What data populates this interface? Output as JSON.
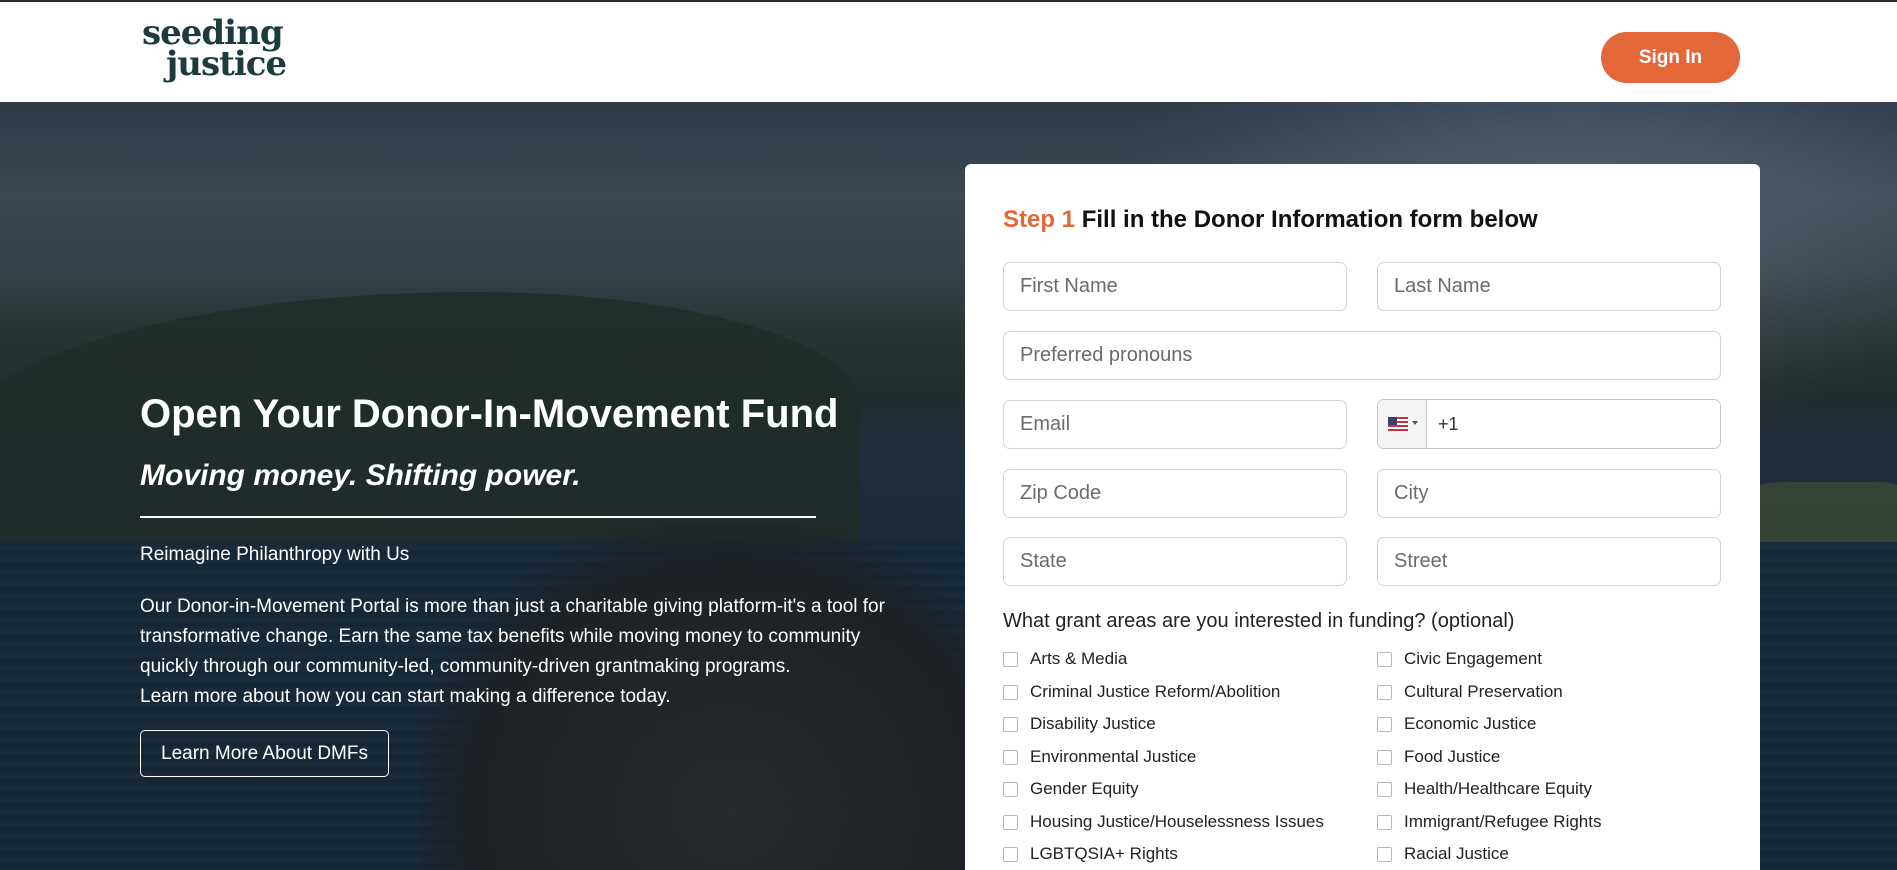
{
  "header": {
    "logo_line1": "seeding",
    "logo_line2": "justice",
    "sign_in_label": "Sign In"
  },
  "hero": {
    "title": "Open Your Donor-In-Movement Fund",
    "subtitle": "Moving money. Shifting power.",
    "kicker": "Reimagine Philanthropy with Us",
    "body_lines": [
      "Our Donor-in-Movement Portal is more than just a charitable giving platform-it's a tool for",
      "transformative change. Earn the same tax benefits while moving money to community",
      "quickly through our community-led, community-driven grantmaking programs.",
      "Learn more about how you can start making a difference today."
    ],
    "cta_label": "Learn More About DMFs"
  },
  "form": {
    "step_label": "Step 1",
    "title": "Fill in the Donor Information form below",
    "placeholders": {
      "first_name": "First Name",
      "last_name": "Last Name",
      "pronouns": "Preferred pronouns",
      "email": "Email",
      "zip": "Zip Code",
      "city": "City",
      "state": "State",
      "street": "Street"
    },
    "phone": {
      "country_icon": "us-flag-icon",
      "value": "+1"
    },
    "grant_question": "What grant areas are you interested in funding? (optional)",
    "grant_areas_left": [
      "Arts & Media",
      "Criminal Justice Reform/Abolition",
      "Disability Justice",
      "Environmental Justice",
      "Gender Equity",
      "Housing Justice/Houselessness Issues",
      "LGBTQSIA+ Rights"
    ],
    "grant_areas_right": [
      "Civic Engagement",
      "Cultural Preservation",
      "Economic Justice",
      "Food Justice",
      "Health/Healthcare Equity",
      "Immigrant/Refugee Rights",
      "Racial Justice"
    ]
  },
  "colors": {
    "accent": "#e4673a",
    "logo_dark": "#1d3b3f",
    "logo_green": "#6fa34a"
  }
}
